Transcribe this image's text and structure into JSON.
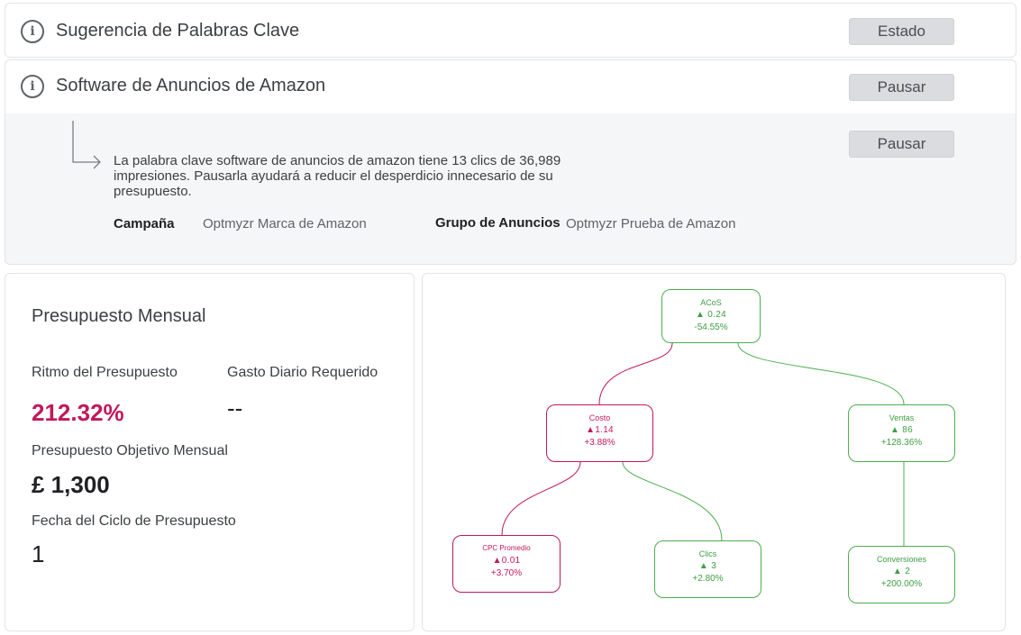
{
  "panels": [
    {
      "title": "Sugerencia de Palabras Clave",
      "button": "Estado"
    },
    {
      "title": "Software de Anuncios de Amazon",
      "button": "Pausar"
    }
  ],
  "suggestion": {
    "button": "Pausar",
    "description": "La palabra clave software de anuncios de amazon tiene 13 clics de 36,989 impresiones. Pausarla ayudará a reducir el desperdicio innecesario de su presupuesto.",
    "campaign_label": "Campaña",
    "campaign_value": "Optmyzr Marca de Amazon",
    "adgroup_label": "Grupo de Anuncios",
    "adgroup_value": "Optmyzr Prueba de Amazon"
  },
  "budget": {
    "title": "Presupuesto Mensual",
    "pace_label": "Ritmo del Presupuesto",
    "pace_value": "212.32%",
    "daily_label": "Gasto Diario Requerido",
    "daily_value": "--",
    "target_label": "Presupuesto Objetivo Mensual",
    "target_value": "£ 1,300",
    "cycle_label": "Fecha del Ciclo de Presupuesto",
    "cycle_value": "1"
  },
  "tree": {
    "acos": {
      "name": "ACoS",
      "value": "▲ 0.24",
      "change": "-54.55%"
    },
    "costo": {
      "name": "Costo",
      "value": "▲1.14",
      "change": "+3.88%"
    },
    "ventas": {
      "name": "Ventas",
      "value": "▲ 86",
      "change": "+128.36%"
    },
    "cpc": {
      "name": "CPC Promedio",
      "value": "▲0.01",
      "change": "+3.70%"
    },
    "clics": {
      "name": "Clics",
      "value": "▲ 3",
      "change": "+2.80%"
    },
    "conversiones": {
      "name": "Conversiones",
      "value": "▲ 2",
      "change": "+200.00%"
    }
  },
  "colors": {
    "green": "#4caf50",
    "red": "#c2185b"
  }
}
